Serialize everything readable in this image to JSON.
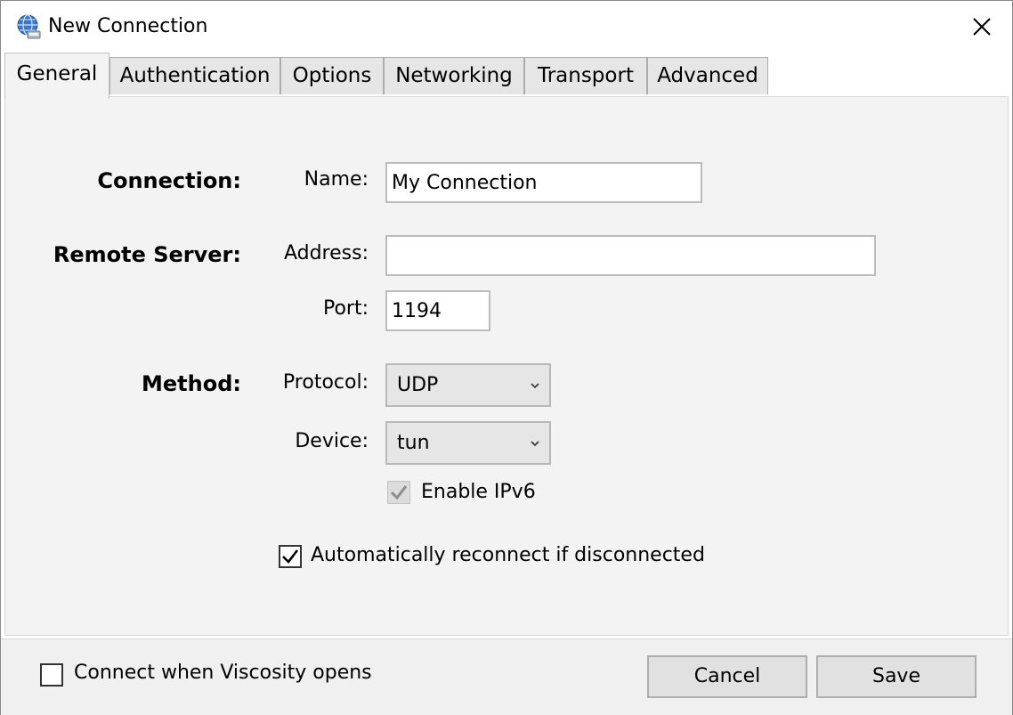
{
  "window": {
    "title": "New Connection",
    "close_icon": "close-icon",
    "app_icon": "globe-network-icon"
  },
  "tabs": [
    {
      "label": "General",
      "active": true
    },
    {
      "label": "Authentication",
      "active": false
    },
    {
      "label": "Options",
      "active": false
    },
    {
      "label": "Networking",
      "active": false
    },
    {
      "label": "Transport",
      "active": false
    },
    {
      "label": "Advanced",
      "active": false
    }
  ],
  "general": {
    "connection_section": "Connection:",
    "name_label": "Name:",
    "name_value": "My Connection",
    "remote_section": "Remote Server:",
    "address_label": "Address:",
    "address_value": "",
    "port_label": "Port:",
    "port_value": "1194",
    "method_section": "Method:",
    "protocol_label": "Protocol:",
    "protocol_value": "UDP",
    "device_label": "Device:",
    "device_value": "tun",
    "enable_ipv6_label": "Enable IPv6",
    "enable_ipv6_checked": true,
    "enable_ipv6_disabled": true,
    "auto_reconnect_label": "Automatically reconnect if disconnected",
    "auto_reconnect_checked": true
  },
  "footer": {
    "connect_on_open_label": "Connect when Viscosity opens",
    "connect_on_open_checked": false,
    "cancel_label": "Cancel",
    "save_label": "Save"
  },
  "colors": {
    "panel_bg": "#f3f3f3",
    "tab_bg": "#e6e6e6",
    "button_bg": "#e1e1e1",
    "border": "#adadad"
  }
}
